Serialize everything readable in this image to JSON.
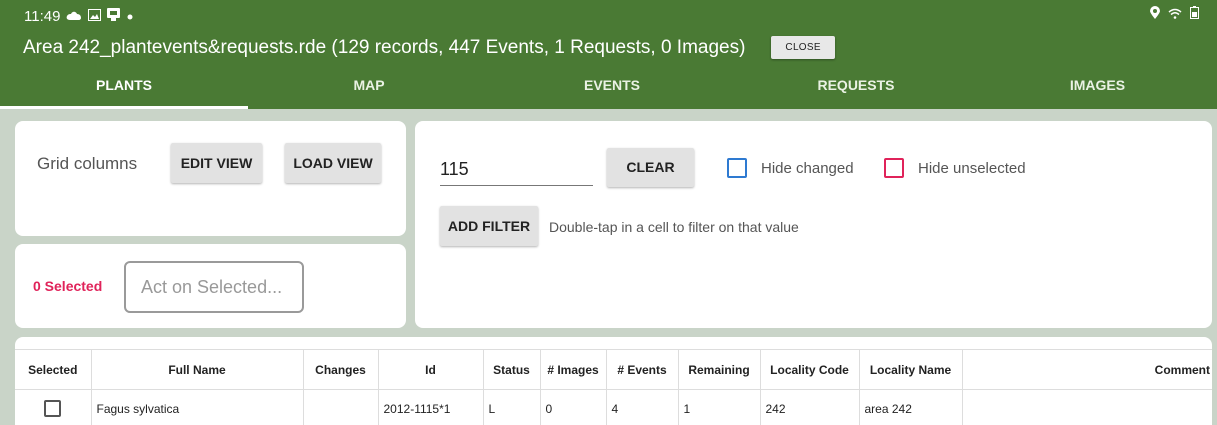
{
  "status_bar": {
    "time": "11:49",
    "icons": [
      "cloud-icon",
      "image-icon",
      "screen-share-icon",
      "dot-icon"
    ],
    "right_icons": [
      "location-icon",
      "wifi-icon",
      "battery-icon"
    ]
  },
  "header": {
    "title": "Area 242_plantevents&requests.rde (129 records, 447 Events, 1 Requests, 0 Images)",
    "close_label": "CLOSE",
    "color": "#4a7a34"
  },
  "tabs": [
    {
      "label": "PLANTS",
      "active": true
    },
    {
      "label": "MAP",
      "active": false
    },
    {
      "label": "EVENTS",
      "active": false
    },
    {
      "label": "REQUESTS",
      "active": false
    },
    {
      "label": "IMAGES",
      "active": false
    }
  ],
  "grid": {
    "label": "Grid columns",
    "edit_view": "EDIT VIEW",
    "load_view": "LOAD VIEW"
  },
  "selection": {
    "count_label": "0 Selected",
    "act_placeholder": "Act on Selected..."
  },
  "filter": {
    "value": "115",
    "clear_label": "CLEAR",
    "hide_changed": "Hide changed",
    "hide_unselected": "Hide unselected",
    "add_filter": "ADD FILTER",
    "hint": "Double-tap in a cell to filter on that value"
  },
  "table": {
    "columns": [
      "Selected",
      "Full Name",
      "Changes",
      "Id",
      "Status",
      "# Images",
      "# Events",
      "Remaining",
      "Locality Code",
      "Locality Name",
      "Comment"
    ],
    "rows": [
      {
        "selected": false,
        "full_name": "Fagus sylvatica",
        "changes": "",
        "id": "2012-1115*1",
        "status": "L",
        "images": "0",
        "events": "4",
        "remaining": "1",
        "locality_code": "242",
        "locality_name": "area 242",
        "comment": ""
      }
    ]
  },
  "colors": {
    "accent_green": "#4a7a34",
    "selected_pink": "#e0235a",
    "checkbox_blue": "#2e7ad1"
  }
}
